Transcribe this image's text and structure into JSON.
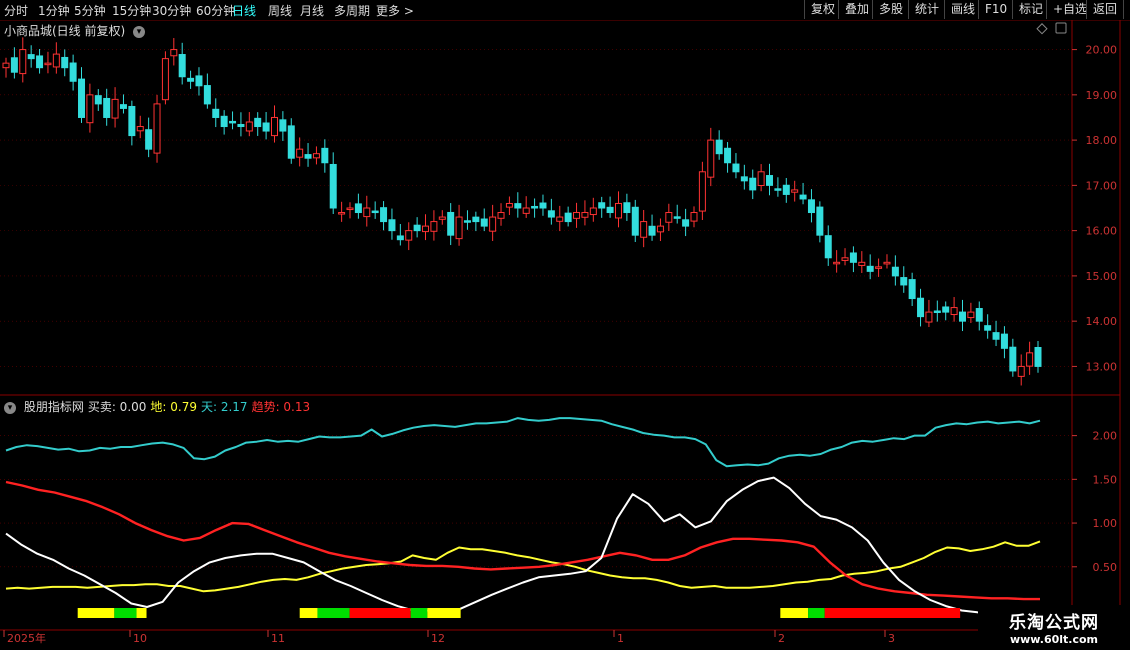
{
  "toolbar": {
    "tabs": [
      "分时",
      "1分钟",
      "5分钟",
      "15分钟",
      "30分钟",
      "60分钟",
      "日线",
      "周线",
      "月线",
      "多周期",
      "更多 >"
    ],
    "active_tab": "日线",
    "right_buttons": [
      "复权",
      "叠加",
      "多股",
      "统计",
      "画线",
      "F10",
      "标记",
      "+自选",
      "返回"
    ]
  },
  "main_chart": {
    "title": "小商品城(日线 前复权)",
    "y_ticks": [
      "20.00",
      "19.00",
      "18.00",
      "17.00",
      "16.00",
      "15.00",
      "14.00",
      "13.00"
    ]
  },
  "indicator": {
    "name": "股朋指标网",
    "items": [
      {
        "label": "买卖:",
        "value": "0.00",
        "color": "#dddddd"
      },
      {
        "label": "地:",
        "value": "0.79",
        "color": "#ffff33"
      },
      {
        "label": "天:",
        "value": "2.17",
        "color": "#33cccc"
      },
      {
        "label": "趋势:",
        "value": "0.13",
        "color": "#ff3333"
      }
    ],
    "y_ticks": [
      "2.00",
      "1.50",
      "1.00",
      "0.50"
    ]
  },
  "x_axis": [
    "2025年",
    "10",
    "11",
    "12",
    "1",
    "2",
    "3"
  ],
  "watermark": {
    "line1": "乐淘公式网",
    "line2": "www.60lt.com"
  },
  "colors": {
    "up": "#ff3333",
    "down": "#33dddd",
    "bg": "#000000",
    "grid": "#6a0000",
    "tian": "#33cccc",
    "di": "#ffff33",
    "trend": "#ff2222",
    "buysell": "#ffffff"
  },
  "chart_data": {
    "type": "candlestick",
    "ylim": [
      12.7,
      20.3
    ],
    "closes": [
      19.7,
      19.5,
      20.0,
      19.8,
      19.6,
      19.7,
      19.9,
      19.6,
      19.3,
      18.5,
      19.0,
      18.8,
      18.5,
      18.9,
      18.7,
      18.1,
      18.3,
      17.8,
      18.8,
      19.8,
      20.0,
      19.4,
      19.3,
      19.2,
      18.8,
      18.5,
      18.3,
      18.4,
      18.3,
      18.4,
      18.3,
      18.2,
      18.5,
      18.2,
      17.6,
      17.8,
      17.6,
      17.7,
      17.5,
      16.5,
      16.4,
      16.5,
      16.4,
      16.5,
      16.4,
      16.2,
      16.0,
      15.8,
      16.0,
      16.0,
      16.1,
      16.2,
      16.3,
      15.9,
      16.3,
      16.2,
      16.2,
      16.1,
      16.3,
      16.4,
      16.6,
      16.5,
      16.5,
      16.5,
      16.5,
      16.3,
      16.3,
      16.2,
      16.4,
      16.4,
      16.5,
      16.5,
      16.4,
      16.6,
      16.4,
      15.9,
      16.2,
      15.9,
      16.1,
      16.4,
      16.3,
      16.1,
      16.4,
      17.3,
      18.0,
      17.7,
      17.5,
      17.3,
      17.1,
      16.9,
      17.3,
      17.0,
      16.9,
      16.8,
      16.9,
      16.7,
      16.4,
      15.9,
      15.4,
      15.3,
      15.4,
      15.3,
      15.3,
      15.1,
      15.2,
      15.3,
      15.0,
      14.8,
      14.5,
      14.1,
      14.2,
      14.2,
      14.2,
      14.3,
      14.0,
      14.2,
      14.0,
      13.8,
      13.6,
      13.4,
      12.9,
      13.0,
      13.3,
      13.0
    ]
  },
  "chart_data_indicator": {
    "type": "line",
    "ylim": [
      -0.2,
      2.35
    ],
    "series": [
      {
        "name": "天",
        "values": [
          1.83,
          1.87,
          1.89,
          1.88,
          1.86,
          1.84,
          1.85,
          1.82,
          1.83,
          1.86,
          1.85,
          1.87,
          1.87,
          1.89,
          1.91,
          1.92,
          1.9,
          1.86,
          1.74,
          1.73,
          1.76,
          1.83,
          1.87,
          1.92,
          1.93,
          1.95,
          1.93,
          1.94,
          1.93,
          1.96,
          1.99,
          1.98,
          1.98,
          1.99,
          2.0,
          2.07,
          1.99,
          2.02,
          2.06,
          2.09,
          2.11,
          2.12,
          2.11,
          2.1,
          2.12,
          2.14,
          2.14,
          2.15,
          2.16,
          2.2,
          2.18,
          2.17,
          2.18,
          2.2,
          2.2,
          2.19,
          2.18,
          2.17,
          2.13,
          2.1,
          2.07,
          2.03,
          2.01,
          2.0,
          1.98,
          1.98,
          1.96,
          1.9,
          1.72,
          1.65,
          1.66,
          1.67,
          1.66,
          1.68,
          1.74,
          1.77,
          1.78,
          1.77,
          1.79,
          1.84,
          1.87,
          1.92,
          1.94,
          1.93,
          1.95,
          1.97,
          1.96,
          2.0,
          2.0,
          2.09,
          2.12,
          2.14,
          2.13,
          2.15,
          2.16,
          2.14,
          2.15,
          2.16,
          2.14,
          2.17
        ]
      },
      {
        "name": "地",
        "values": [
          0.25,
          0.26,
          0.25,
          0.26,
          0.27,
          0.27,
          0.27,
          0.26,
          0.27,
          0.28,
          0.29,
          0.29,
          0.3,
          0.3,
          0.28,
          0.28,
          0.25,
          0.22,
          0.23,
          0.25,
          0.27,
          0.3,
          0.33,
          0.35,
          0.36,
          0.35,
          0.38,
          0.42,
          0.45,
          0.48,
          0.5,
          0.52,
          0.53,
          0.54,
          0.56,
          0.63,
          0.6,
          0.58,
          0.66,
          0.72,
          0.7,
          0.7,
          0.68,
          0.66,
          0.63,
          0.61,
          0.58,
          0.55,
          0.53,
          0.5,
          0.46,
          0.43,
          0.4,
          0.38,
          0.37,
          0.37,
          0.35,
          0.32,
          0.28,
          0.26,
          0.27,
          0.28,
          0.26,
          0.26,
          0.26,
          0.27,
          0.28,
          0.3,
          0.32,
          0.33,
          0.35,
          0.36,
          0.4,
          0.42,
          0.43,
          0.45,
          0.48,
          0.5,
          0.55,
          0.6,
          0.67,
          0.72,
          0.71,
          0.68,
          0.7,
          0.73,
          0.78,
          0.74,
          0.74,
          0.79
        ]
      },
      {
        "name": "趋势",
        "values": [
          1.47,
          1.43,
          1.38,
          1.35,
          1.3,
          1.25,
          1.18,
          1.1,
          1.0,
          0.92,
          0.85,
          0.8,
          0.83,
          0.92,
          1.0,
          0.99,
          0.92,
          0.85,
          0.78,
          0.72,
          0.66,
          0.62,
          0.59,
          0.56,
          0.54,
          0.52,
          0.51,
          0.51,
          0.5,
          0.48,
          0.47,
          0.48,
          0.49,
          0.5,
          0.52,
          0.55,
          0.58,
          0.62,
          0.66,
          0.63,
          0.58,
          0.58,
          0.63,
          0.72,
          0.78,
          0.82,
          0.82,
          0.81,
          0.8,
          0.78,
          0.73,
          0.55,
          0.4,
          0.3,
          0.25,
          0.22,
          0.2,
          0.18,
          0.17,
          0.16,
          0.15,
          0.14,
          0.14,
          0.13,
          0.13
        ]
      },
      {
        "name": "买卖",
        "values": [
          0.88,
          0.75,
          0.65,
          0.58,
          0.48,
          0.4,
          0.3,
          0.2,
          0.08,
          0.04,
          0.1,
          0.32,
          0.45,
          0.55,
          0.6,
          0.63,
          0.65,
          0.65,
          0.6,
          0.55,
          0.45,
          0.35,
          0.28,
          0.2,
          0.12,
          0.05,
          0.0,
          0.0,
          -0.02,
          0.02,
          0.1,
          0.18,
          0.25,
          0.32,
          0.38,
          0.4,
          0.42,
          0.45,
          0.6,
          1.05,
          1.33,
          1.22,
          1.02,
          1.1,
          0.95,
          1.02,
          1.25,
          1.38,
          1.48,
          1.52,
          1.4,
          1.22,
          1.08,
          1.04,
          0.95,
          0.8,
          0.55,
          0.35,
          0.22,
          0.12,
          0.05,
          0.0,
          -0.02,
          -0.05,
          -0.02,
          0.0,
          0.0
        ]
      }
    ]
  },
  "signal_bars": [
    {
      "color": "#ffff00",
      "from": 0.07,
      "to": 0.103
    },
    {
      "color": "#00dd00",
      "from": 0.103,
      "to": 0.123
    },
    {
      "color": "#ffff00",
      "from": 0.123,
      "to": 0.132
    },
    {
      "color": "#ffff00",
      "from": 0.27,
      "to": 0.286
    },
    {
      "color": "#00dd00",
      "from": 0.286,
      "to": 0.315
    },
    {
      "color": "#ff0000",
      "from": 0.315,
      "to": 0.37
    },
    {
      "color": "#00dd00",
      "from": 0.37,
      "to": 0.385
    },
    {
      "color": "#ffff00",
      "from": 0.385,
      "to": 0.415
    },
    {
      "color": "#ffff00",
      "from": 0.703,
      "to": 0.728
    },
    {
      "color": "#00dd00",
      "from": 0.728,
      "to": 0.743
    },
    {
      "color": "#ff0000",
      "from": 0.743,
      "to": 0.865
    }
  ]
}
